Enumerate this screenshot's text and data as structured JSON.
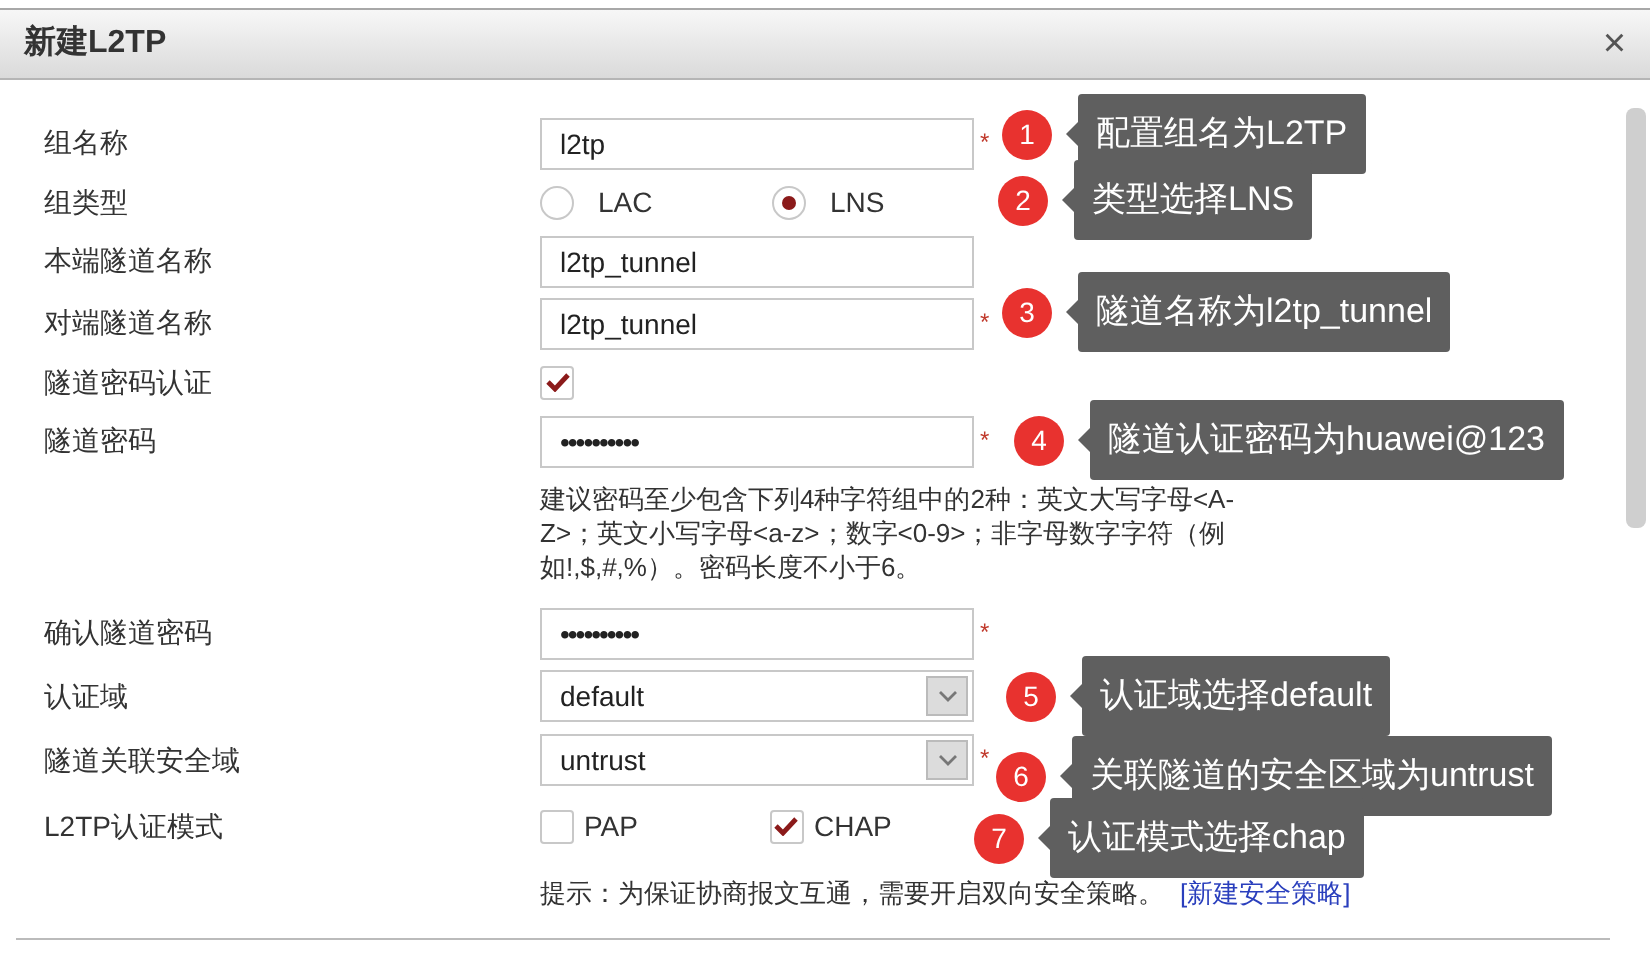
{
  "dialog": {
    "title": "新建L2TP",
    "close": "×"
  },
  "fields": [
    {
      "kind": "text",
      "label": "组名称",
      "value": "l2tp",
      "required_mark": "*"
    },
    {
      "kind": "radio",
      "label": "组类型",
      "options": [
        {
          "label": "LAC",
          "selected": false
        },
        {
          "label": "LNS",
          "selected": true
        }
      ]
    },
    {
      "kind": "text",
      "label": "本端隧道名称",
      "value": "l2tp_tunnel"
    },
    {
      "kind": "text",
      "label": "对端隧道名称",
      "value": "l2tp_tunnel",
      "required_mark": "*"
    },
    {
      "kind": "checkbox",
      "label": "隧道密码认证",
      "checked": true
    },
    {
      "kind": "password",
      "label": "隧道密码",
      "value": "••••••••••",
      "required_mark": "*"
    },
    {
      "kind": "hint",
      "text": "建议密码至少包含下列4种字符组中的2种：英文大写字母<A-Z>；英文小写字母<a-z>；数字<0-9>；非字母数字字符（例如!,$,#,%）。密码长度不小于6。"
    },
    {
      "kind": "password",
      "label": "确认隧道密码",
      "value": "••••••••••",
      "required_mark": "*"
    },
    {
      "kind": "select",
      "label": "认证域",
      "value": "default"
    },
    {
      "kind": "select",
      "label": "隧道关联安全域",
      "value": "untrust",
      "required_mark": "*"
    },
    {
      "kind": "checkboxes",
      "label": "L2TP认证模式",
      "options": [
        {
          "label": "PAP",
          "checked": false
        },
        {
          "label": "CHAP",
          "checked": true
        }
      ]
    },
    {
      "kind": "hint",
      "text": "提示：为保证协商报文互通，需要开启双向安全策略。",
      "link": "[新建安全策略]"
    }
  ],
  "callouts": [
    {
      "number": "1",
      "text": "配置组名为L2TP"
    },
    {
      "number": "2",
      "text": "类型选择LNS"
    },
    {
      "number": "3",
      "text": "隧道名称为l2tp_tunnel"
    },
    {
      "number": "4",
      "text": "隧道认证密码为huawei@123"
    },
    {
      "number": "5",
      "text": "认证域选择default"
    },
    {
      "number": "6",
      "text": "关联隧道的安全区域为untrust"
    },
    {
      "number": "7",
      "text": "认证模式选择chap"
    }
  ]
}
